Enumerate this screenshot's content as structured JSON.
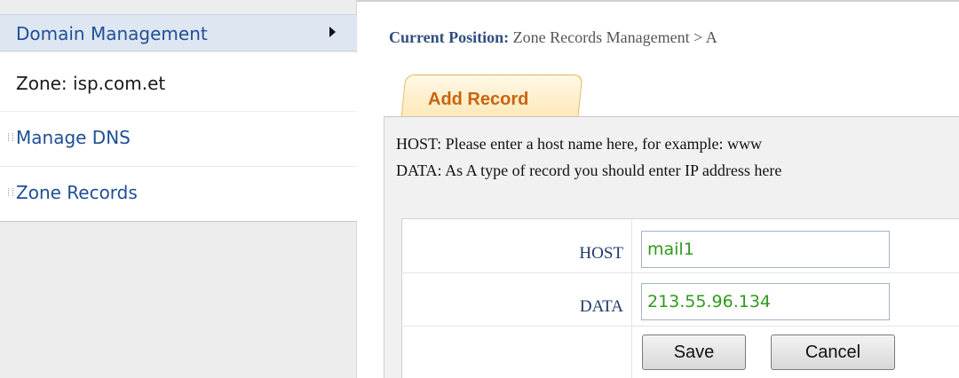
{
  "sidebar": {
    "header_label": "Domain Management",
    "zone_label": "Zone: isp.com.et",
    "items": [
      {
        "label": "Manage DNS"
      },
      {
        "label": "Zone Records"
      }
    ]
  },
  "breadcrumb": {
    "label": "Current Position:",
    "path": "Zone Records Management > A"
  },
  "tab": {
    "label": "Add Record"
  },
  "hints": {
    "host": "HOST: Please enter a host name here, for example: www",
    "data": "DATA: As A type of record you should enter IP address here"
  },
  "form": {
    "host_label": "HOST",
    "host_value": "mail1",
    "data_label": "DATA",
    "data_value": "213.55.96.134",
    "save_label": "Save",
    "cancel_label": "Cancel"
  },
  "colors": {
    "link_blue": "#1f4f96",
    "tab_orange": "#c8640e",
    "value_green": "#2f9a1f"
  }
}
